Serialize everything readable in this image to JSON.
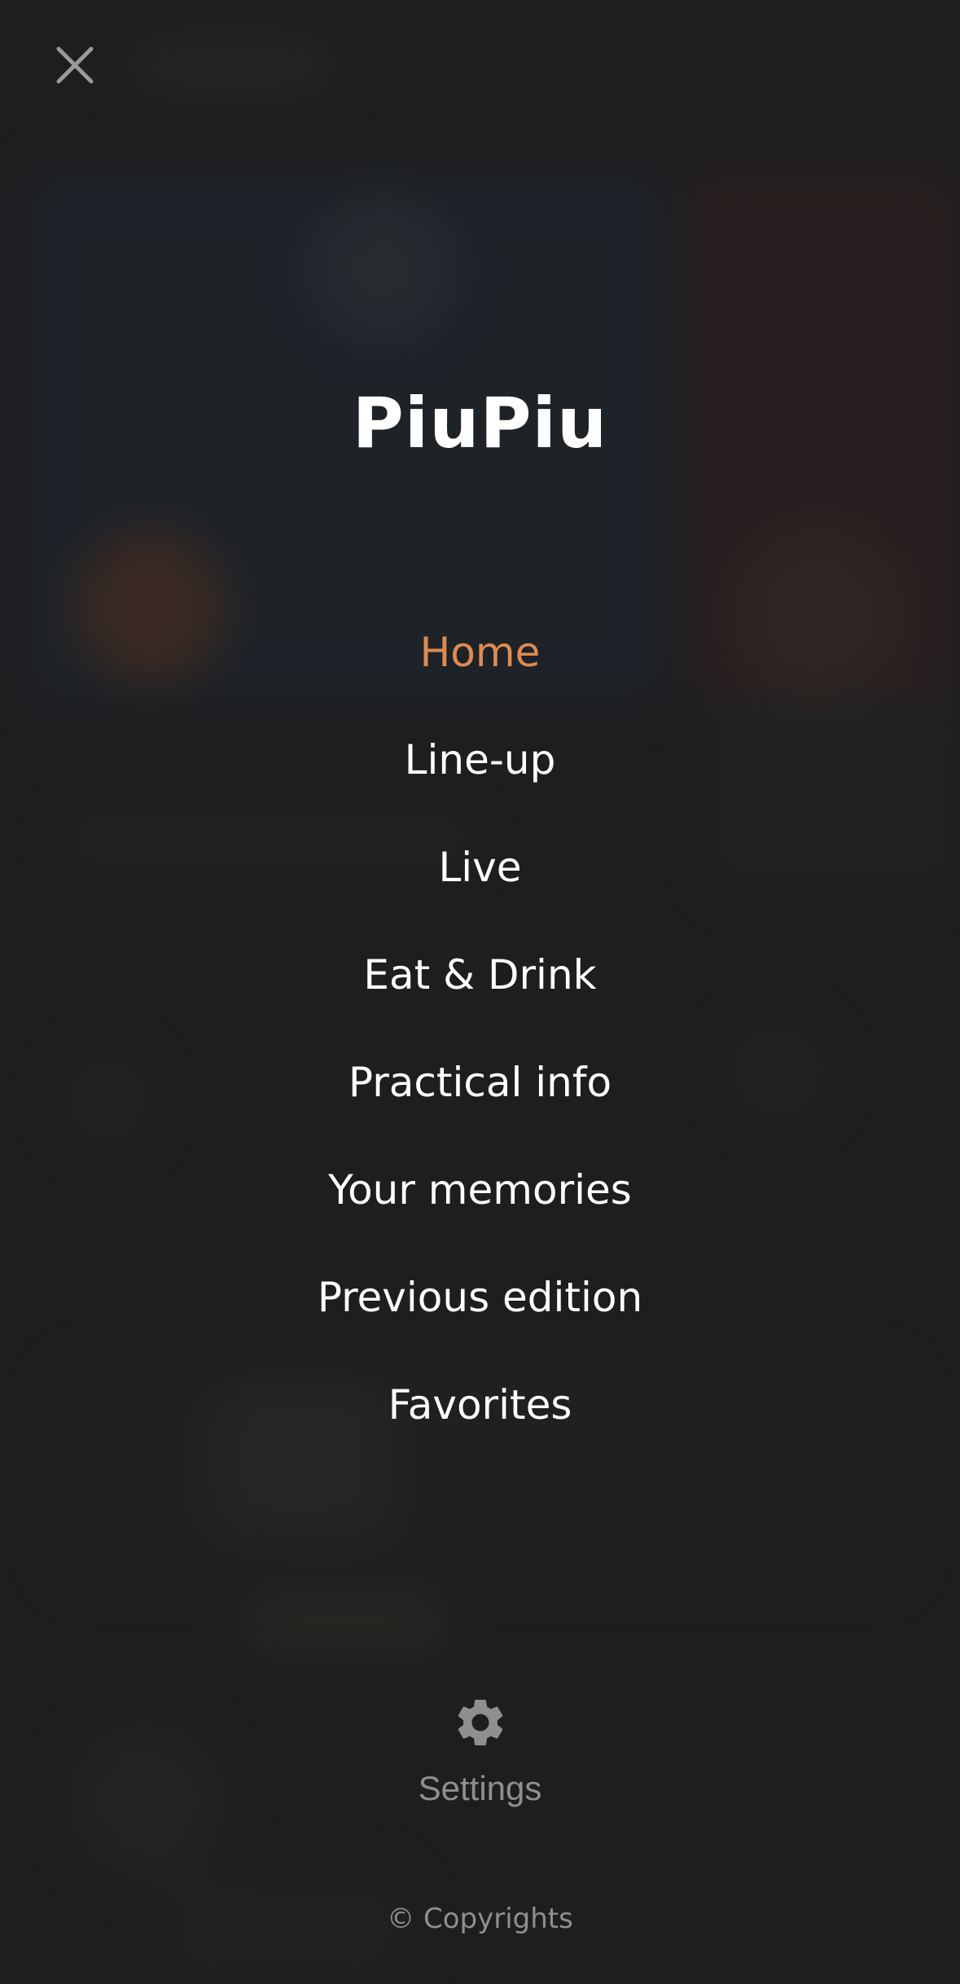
{
  "close_icon": "close-icon",
  "app_title": "PiuPiu",
  "nav": {
    "items": [
      {
        "label": "Home",
        "active": true
      },
      {
        "label": "Line-up"
      },
      {
        "label": "Live"
      },
      {
        "label": "Eat & Drink"
      },
      {
        "label": "Practical info"
      },
      {
        "label": "Your memories"
      },
      {
        "label": "Previous edition"
      },
      {
        "label": "Favorites"
      }
    ]
  },
  "settings": {
    "icon": "gear-icon",
    "label": "Settings"
  },
  "footer": {
    "copyright": "© Copyrights"
  },
  "colors": {
    "background": "#1f1f20",
    "accent": "#e08a4f",
    "text": "#ffffff",
    "muted": "#8f8f91"
  }
}
